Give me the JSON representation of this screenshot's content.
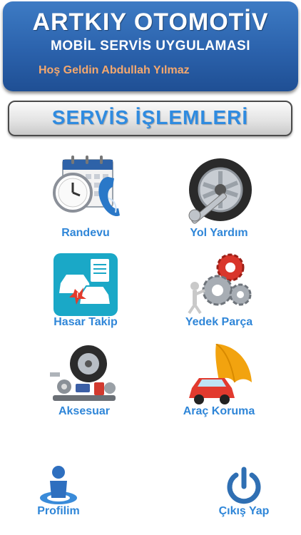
{
  "header": {
    "title": "ARTKIY OTOMOTİV",
    "subtitle": "MOBİL SERVİS UYGULAMASI",
    "welcome": "Hoş Geldin Abdullah Yılmaz"
  },
  "section": {
    "title": "SERVİS İŞLEMLERİ"
  },
  "services": [
    {
      "label": "Randevu",
      "icon": "calendar-clock-phone-icon"
    },
    {
      "label": "Yol Yardım",
      "icon": "tire-wrench-icon"
    },
    {
      "label": "Hasar Takip",
      "icon": "car-damage-icon"
    },
    {
      "label": "Yedek Parça",
      "icon": "gears-worker-icon"
    },
    {
      "label": "Aksesuar",
      "icon": "car-parts-icon"
    },
    {
      "label": "Araç Koruma",
      "icon": "car-umbrella-icon"
    }
  ],
  "footer": {
    "profile_label": "Profilim",
    "logout_label": "Çıkış Yap"
  },
  "colors": {
    "header": "#2b62ac",
    "label": "#2f86d8",
    "welcome": "#f4a86e"
  }
}
